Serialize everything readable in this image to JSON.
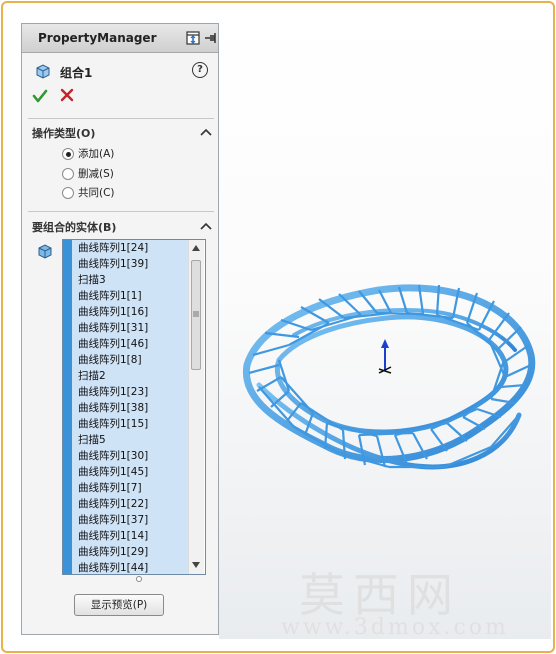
{
  "property_manager": {
    "title": "PropertyManager",
    "feature_name": "组合1",
    "help": "?",
    "operation_group": {
      "title": "操作类型(O)",
      "options": [
        "添加(A)",
        "删减(S)",
        "共同(C)"
      ],
      "selected": "添加(A)"
    },
    "bodies_group": {
      "title": "要组合的实体(B)",
      "items": [
        "曲线阵列1[24]",
        "曲线阵列1[39]",
        "扫描3",
        "曲线阵列1[1]",
        "曲线阵列1[16]",
        "曲线阵列1[31]",
        "曲线阵列1[46]",
        "曲线阵列1[8]",
        "扫描2",
        "曲线阵列1[23]",
        "曲线阵列1[38]",
        "曲线阵列1[15]",
        "扫描5",
        "曲线阵列1[30]",
        "曲线阵列1[45]",
        "曲线阵列1[7]",
        "曲线阵列1[22]",
        "曲线阵列1[37]",
        "曲线阵列1[14]",
        "曲线阵列1[29]",
        "曲线阵列1[44]"
      ]
    },
    "preview_button": "显示预览(P)"
  },
  "watermark": {
    "brand": "莫西网",
    "url": "www.3dmox.com"
  },
  "colors": {
    "accent": "#3a92d9",
    "model": "#4aa3e6",
    "frame": "#e6b24a",
    "ok": "#2e9a2e",
    "cancel": "#c0262b"
  }
}
